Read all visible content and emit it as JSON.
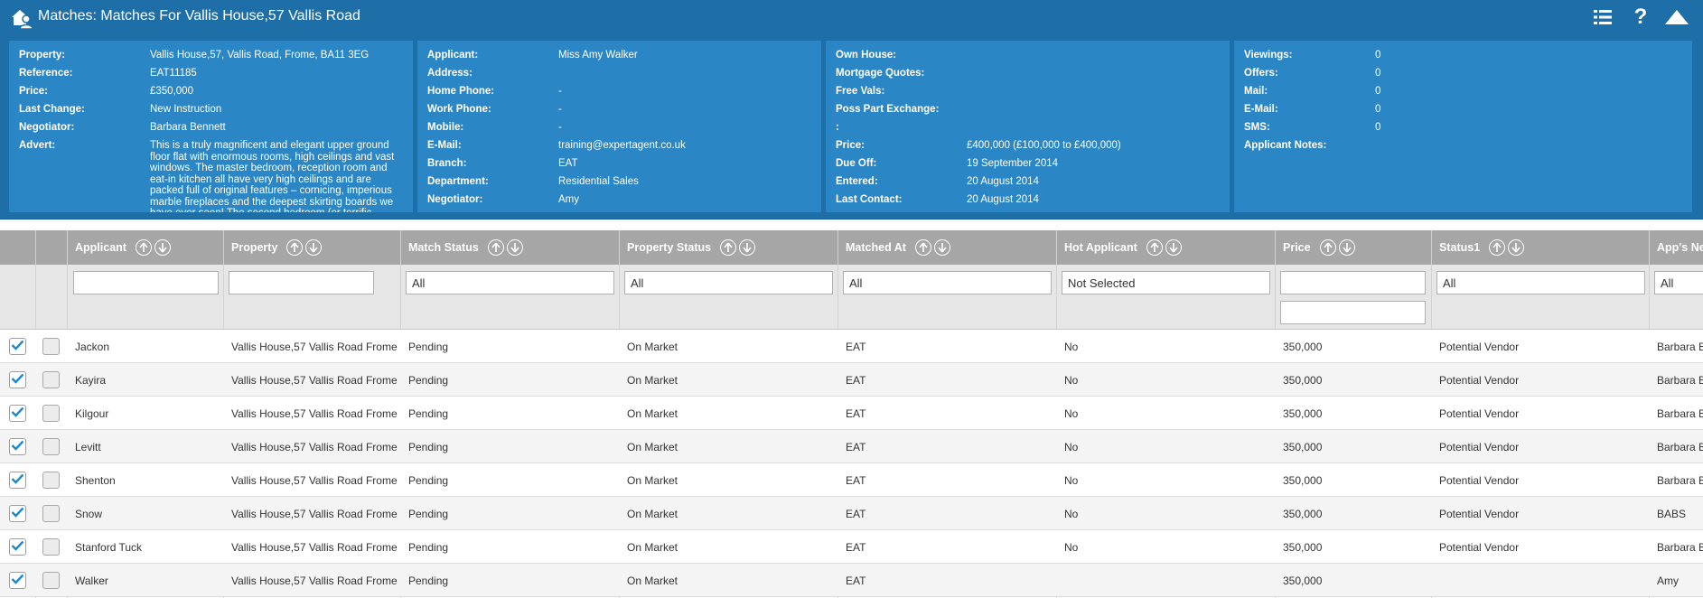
{
  "title": "Matches: Matches For Vallis House,57 Vallis Road",
  "icons": {
    "app": "house-person-icon",
    "list": "list-icon",
    "help": "question-icon",
    "collapse": "triangle-up-icon",
    "sort_up": "sort-up-icon",
    "sort_down": "sort-down-icon",
    "check": "checkmark-icon"
  },
  "colors": {
    "header_bg": "#1e6fa8",
    "panel_bg": "#2a86c4",
    "grid_header_bg": "#a6a6a6",
    "check_color": "#1e88c9"
  },
  "property_panel": [
    {
      "label": "Property:",
      "value": "Vallis House,57, Vallis Road, Frome, BA11 3EG"
    },
    {
      "label": "Reference:",
      "value": "EAT11185"
    },
    {
      "label": "Price:",
      "value": "£350,000"
    },
    {
      "label": "Last Change:",
      "value": "New Instruction"
    },
    {
      "label": "Negotiator:",
      "value": "Barbara Bennett"
    },
    {
      "label": "Advert:",
      "value": "This is a truly magnificent and elegant upper ground floor flat with enormous rooms, high ceilings and vast windows. The master bedroom, reception room and eat-in kitchen all have very high ceilings and are packed full of original features – cornicing, imperious marble fireplaces and the deepest skirting boards we have ever seen! The second bedroom (or terrific"
    }
  ],
  "applicant_panel": [
    {
      "label": "Applicant:",
      "value": "Miss Amy Walker"
    },
    {
      "label": "Address:",
      "value": ""
    },
    {
      "label": "Home Phone:",
      "value": "-"
    },
    {
      "label": "Work Phone:",
      "value": "-"
    },
    {
      "label": "Mobile:",
      "value": "-"
    },
    {
      "label": "E-Mail:",
      "value": "training@expertagent.co.uk"
    },
    {
      "label": "Branch:",
      "value": "EAT"
    },
    {
      "label": "Department:",
      "value": "Residential Sales"
    },
    {
      "label": "Negotiator:",
      "value": "Amy"
    }
  ],
  "details_panel": [
    {
      "label": "Own House:",
      "value": ""
    },
    {
      "label": "Mortgage Quotes:",
      "value": ""
    },
    {
      "label": "Free Vals:",
      "value": ""
    },
    {
      "label": "Poss Part Exchange:",
      "value": ""
    },
    {
      "label": ":",
      "value": ""
    },
    {
      "label": "Price:",
      "value": "£400,000 (£100,000 to £400,000)"
    },
    {
      "label": "Due Off:",
      "value": "19 September 2014"
    },
    {
      "label": "Entered:",
      "value": "20 August 2014"
    },
    {
      "label": "Last Contact:",
      "value": "20 August 2014"
    }
  ],
  "stats_panel": [
    {
      "label": "Viewings:",
      "value": "0"
    },
    {
      "label": "Offers:",
      "value": "0"
    },
    {
      "label": "Mail:",
      "value": "0"
    },
    {
      "label": "E-Mail:",
      "value": "0"
    },
    {
      "label": "SMS:",
      "value": "0"
    },
    {
      "label": "Applicant Notes:",
      "value": ""
    }
  ],
  "columns": [
    "Applicant",
    "Property",
    "Match Status",
    "Property Status",
    "Matched At",
    "Hot Applicant",
    "Price",
    "Status1",
    "App's Ne"
  ],
  "filters": {
    "applicant": "",
    "property": "",
    "match_status": "All",
    "property_status": "All",
    "matched_at": "All",
    "hot_applicant": "Not Selected",
    "price_from": "",
    "price_to": "",
    "status1": "All",
    "apps_neg": "All"
  },
  "rows": [
    {
      "checked": true,
      "applicant": "Jackon",
      "property": "Vallis House,57 Vallis Road Frome",
      "match_status": "Pending",
      "property_status": "On Market",
      "matched_at": "EAT",
      "hot_applicant": "No",
      "price": "350,000",
      "status1": "Potential Vendor",
      "apps_neg": "Barbara B"
    },
    {
      "checked": true,
      "applicant": "Kayira",
      "property": "Vallis House,57 Vallis Road Frome",
      "match_status": "Pending",
      "property_status": "On Market",
      "matched_at": "EAT",
      "hot_applicant": "No",
      "price": "350,000",
      "status1": "Potential Vendor",
      "apps_neg": "Barbara B"
    },
    {
      "checked": true,
      "applicant": "Kilgour",
      "property": "Vallis House,57 Vallis Road Frome",
      "match_status": "Pending",
      "property_status": "On Market",
      "matched_at": "EAT",
      "hot_applicant": "No",
      "price": "350,000",
      "status1": "Potential Vendor",
      "apps_neg": "Barbara B"
    },
    {
      "checked": true,
      "applicant": "Levitt",
      "property": "Vallis House,57 Vallis Road Frome",
      "match_status": "Pending",
      "property_status": "On Market",
      "matched_at": "EAT",
      "hot_applicant": "No",
      "price": "350,000",
      "status1": "Potential Vendor",
      "apps_neg": "Barbara B"
    },
    {
      "checked": true,
      "applicant": "Shenton",
      "property": "Vallis House,57 Vallis Road Frome",
      "match_status": "Pending",
      "property_status": "On Market",
      "matched_at": "EAT",
      "hot_applicant": "No",
      "price": "350,000",
      "status1": "Potential Vendor",
      "apps_neg": "Barbara B"
    },
    {
      "checked": true,
      "applicant": "Snow",
      "property": "Vallis House,57 Vallis Road Frome",
      "match_status": "Pending",
      "property_status": "On Market",
      "matched_at": "EAT",
      "hot_applicant": "No",
      "price": "350,000",
      "status1": "Potential Vendor",
      "apps_neg": "BABS"
    },
    {
      "checked": true,
      "applicant": "Stanford Tuck",
      "property": "Vallis House,57 Vallis Road Frome",
      "match_status": "Pending",
      "property_status": "On Market",
      "matched_at": "EAT",
      "hot_applicant": "No",
      "price": "350,000",
      "status1": "Potential Vendor",
      "apps_neg": "Barbara B"
    },
    {
      "checked": true,
      "applicant": "Walker",
      "property": "Vallis House,57 Vallis Road Frome",
      "match_status": "Pending",
      "property_status": "On Market",
      "matched_at": "EAT",
      "hot_applicant": "",
      "price": "350,000",
      "status1": "",
      "apps_neg": "Amy"
    }
  ]
}
